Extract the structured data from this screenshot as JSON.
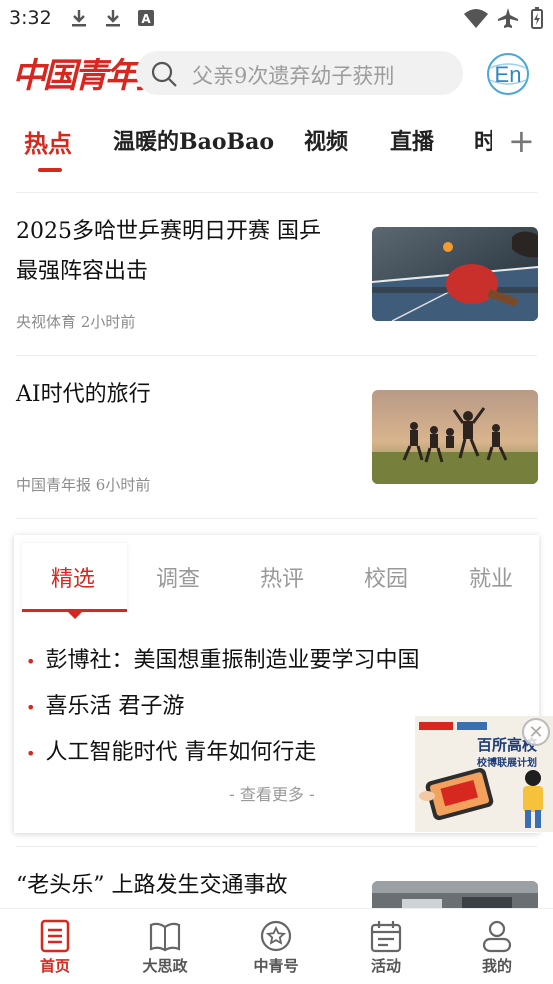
{
  "status_bar": {
    "time": "3:32",
    "icons": [
      "download-icon",
      "download-icon",
      "a-icon",
      "wifi-icon",
      "airplane-icon",
      "battery-icon"
    ]
  },
  "header": {
    "logo_text": "中国青年报",
    "search_placeholder": "父亲9次遗弃幼子获刑",
    "en_button": "En"
  },
  "tabs": {
    "items": [
      "热点",
      "温暖的BaoBao",
      "视频",
      "直播",
      "时"
    ],
    "active": "热点",
    "add_icon": "plus-icon"
  },
  "news": [
    {
      "title": "2025多哈世乒赛明日开赛 国乒最强阵容出击",
      "source": "央视体育",
      "time": "2小时前"
    },
    {
      "title": "AI时代的旅行",
      "source": "中国青年报",
      "time": "6小时前"
    },
    {
      "title": "“老头乐” 上路发生交通事故"
    }
  ],
  "card": {
    "tabs": [
      "精选",
      "调查",
      "热评",
      "校园",
      "就业"
    ],
    "active_tab": "精选",
    "items": [
      "彭博社：美国想重振制造业要学习中国",
      "喜乐活 君子游",
      "人工智能时代 青年如何行走"
    ],
    "more": "- 查看更多 -"
  },
  "promo": {
    "line1": "百所高校",
    "line2": "校博联展计划"
  },
  "bottom_nav": [
    {
      "label": "首页",
      "icon": "news-list-icon",
      "active": true
    },
    {
      "label": "大思政",
      "icon": "open-book-icon"
    },
    {
      "label": "中青号",
      "icon": "star-badge-icon"
    },
    {
      "label": "活动",
      "icon": "calendar-icon"
    },
    {
      "label": "我的",
      "icon": "person-icon"
    }
  ],
  "colors": {
    "brand_red": "#d7281f",
    "text": "#111111",
    "meta": "#8c8c8c"
  }
}
